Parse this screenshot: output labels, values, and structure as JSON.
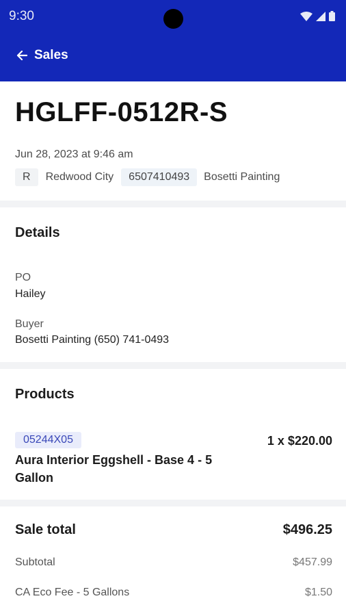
{
  "status_bar": {
    "time": "9:30",
    "icons": [
      "wifi-icon",
      "cell-signal-icon",
      "battery-icon"
    ]
  },
  "app_bar": {
    "back_icon": "arrow-left-icon",
    "back_label": "Sales",
    "color": "#1328b8"
  },
  "sale": {
    "id": "HGLFF-0512R-S",
    "datetime": "Jun 28, 2023 at 9:46 am",
    "store_initial": "R",
    "store_name": "Redwood City",
    "phone": "6507410493",
    "customer": "Bosetti Painting"
  },
  "details": {
    "title": "Details",
    "po_label": "PO",
    "po_value": "Hailey",
    "buyer_label": "Buyer",
    "buyer_value": "Bosetti Painting (650) 741-0493"
  },
  "products": {
    "title": "Products",
    "items": [
      {
        "sku": "05244X05",
        "name": "Aura Interior Eggshell - Base 4 - 5 Gallon",
        "quantity_price": "1 x $220.00"
      }
    ]
  },
  "totals": {
    "sale_total_label": "Sale total",
    "sale_total_value": "$496.25",
    "lines": [
      {
        "label": "Subtotal",
        "value": "$457.99"
      },
      {
        "label": "CA Eco Fee - 5 Gallons",
        "value": "$1.50"
      }
    ]
  }
}
